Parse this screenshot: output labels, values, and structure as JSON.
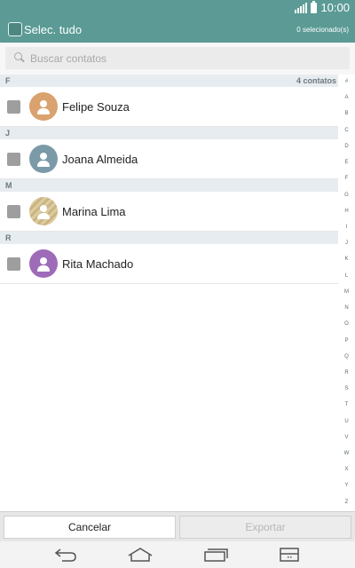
{
  "status_bar": {
    "time": "10:00"
  },
  "header": {
    "select_all_label": "Selec. tudo",
    "selected_count": "0 selecionado(s)"
  },
  "search": {
    "placeholder": "Buscar contatos"
  },
  "contacts_count": "4 contatos",
  "sections": [
    {
      "letter": "F",
      "contact": {
        "name": "Felipe Souza",
        "avatar_color": "#d9a26e"
      }
    },
    {
      "letter": "J",
      "contact": {
        "name": "Joana Almeida",
        "avatar_color": "#7a9aa8"
      }
    },
    {
      "letter": "M",
      "contact": {
        "name": "Marina Lima",
        "avatar_color": "#d4c08f"
      }
    },
    {
      "letter": "R",
      "contact": {
        "name": "Rita Machado",
        "avatar_color": "#9e6bb8"
      }
    }
  ],
  "index_letters": [
    "#",
    "A",
    "B",
    "C",
    "D",
    "E",
    "F",
    "G",
    "H",
    "I",
    "J",
    "K",
    "L",
    "M",
    "N",
    "O",
    "P",
    "Q",
    "R",
    "S",
    "T",
    "U",
    "V",
    "W",
    "X",
    "Y",
    "Z"
  ],
  "buttons": {
    "cancel": "Cancelar",
    "export": "Exportar"
  },
  "nav": {
    "icons": [
      "back-icon",
      "home-icon",
      "recent-apps-icon",
      "menu-icon"
    ]
  },
  "colors": {
    "accent": "#5b9a95"
  }
}
